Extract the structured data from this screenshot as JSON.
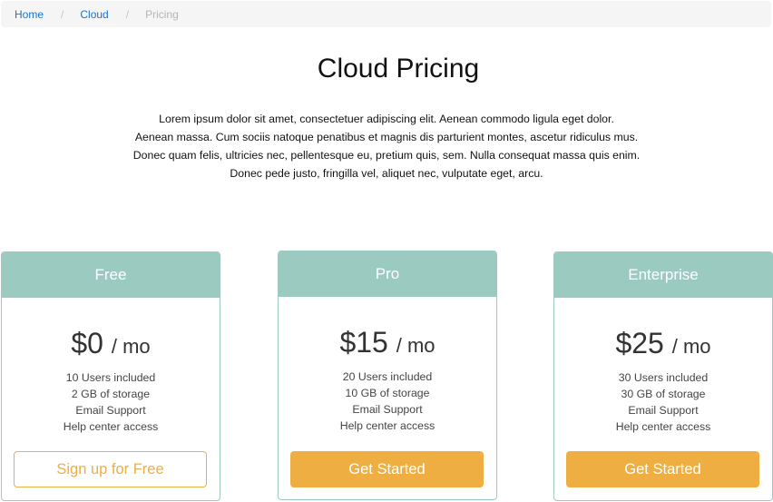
{
  "breadcrumb": {
    "items": [
      "Home",
      "Cloud"
    ],
    "separator": "/",
    "current": "Pricing"
  },
  "page": {
    "title": "Cloud Pricing",
    "lead_lines": [
      "Lorem ipsum dolor sit amet, consectetuer adipiscing elit. Aenean commodo ligula eget dolor.",
      "Aenean massa. Cum sociis natoque penatibus et magnis dis parturient montes, ascetur ridiculus mus.",
      "Donec quam felis, ultricies nec, pellentesque eu, pretium quis, sem. Nulla consequat massa quis enim.",
      "Donec pede justo, fringilla vel, aliquet nec, vulputate eget, arcu."
    ]
  },
  "plans": [
    {
      "name": "Free",
      "price": "$0",
      "per": "/ mo",
      "features": [
        "10 Users included",
        "2 GB of storage",
        "Email Support",
        "Help center access"
      ],
      "cta": "Sign up for Free"
    },
    {
      "name": "Pro",
      "price": "$15",
      "per": "/ mo",
      "features": [
        "20 Users included",
        "10 GB of storage",
        "Email Support",
        "Help center access"
      ],
      "cta": "Get Started"
    },
    {
      "name": "Enterprise",
      "price": "$25",
      "per": "/ mo",
      "features": [
        "30 Users included",
        "30 GB of storage",
        "Email Support",
        "Help center access"
      ],
      "cta": "Get Started"
    }
  ],
  "colors": {
    "header_bg": "#9bcac1",
    "accent": "#efae42",
    "link": "#1a73c9"
  }
}
